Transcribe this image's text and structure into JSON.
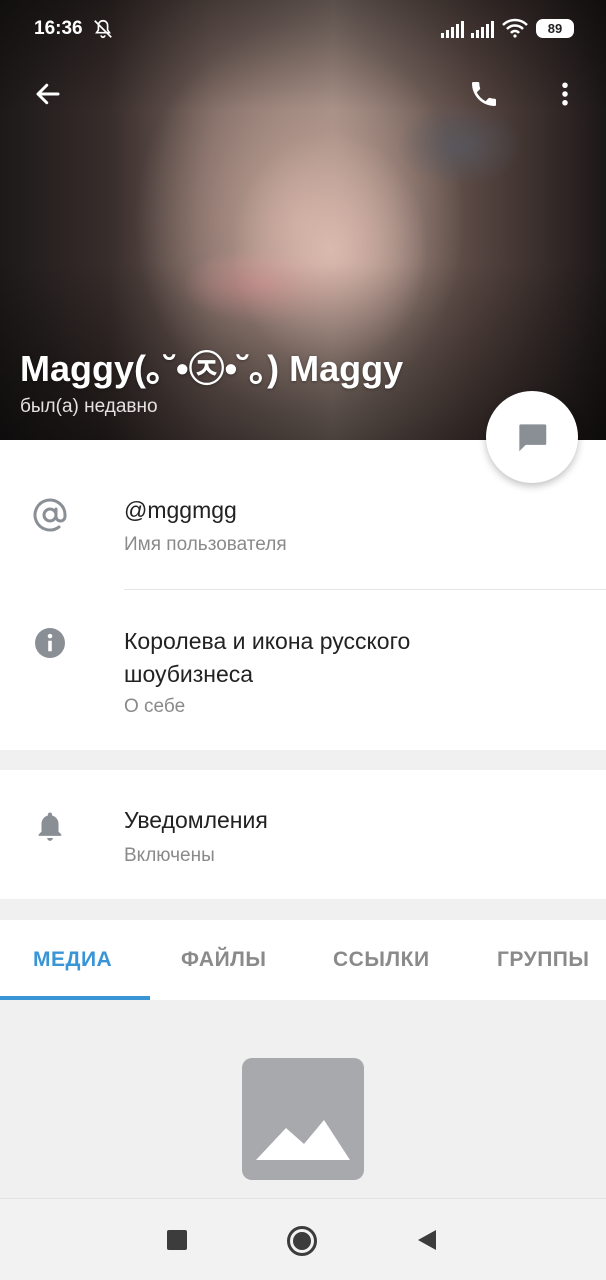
{
  "status_bar": {
    "time": "16:36",
    "battery": "89",
    "icons": [
      "mute-icon",
      "signal-icon",
      "signal-icon",
      "wifi-icon"
    ]
  },
  "header": {
    "name": "Maggy(｡˘•㉨•˘｡) Maggy",
    "last_seen": "был(а) недавно",
    "icons": [
      "back-arrow-icon",
      "phone-icon",
      "more-vert-icon",
      "message-icon"
    ]
  },
  "info": {
    "username": {
      "value": "@mggmgg",
      "label": "Имя пользователя",
      "icon": "at-icon"
    },
    "bio": {
      "line1": "Королева и икона русского",
      "line2": "шоубизнеса",
      "label": "О себе",
      "icon": "info-icon"
    },
    "notifications": {
      "title": "Уведомления",
      "value": "Включены",
      "icon": "bell-icon"
    }
  },
  "tabs": [
    {
      "label": "МЕДИА"
    },
    {
      "label": "ФАЙЛЫ"
    },
    {
      "label": "ССЫЛКИ"
    },
    {
      "label": "ГРУППЫ"
    }
  ],
  "colors": {
    "accent": "#3a95d6",
    "icon_gray": "#8a8f96",
    "secondary_text": "#8a8a8a"
  },
  "nav_bar": {
    "icons": [
      "recents-square-icon",
      "home-circle-icon",
      "back-triangle-icon"
    ]
  }
}
